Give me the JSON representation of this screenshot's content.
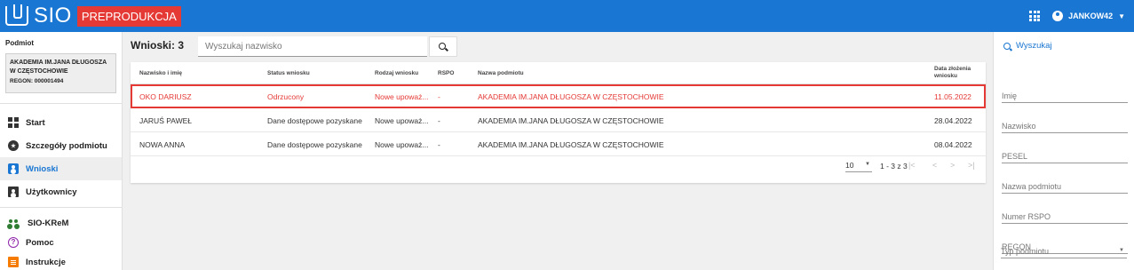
{
  "app": {
    "name": "SIO",
    "env_badge": "PREPRODUKCJA"
  },
  "user": {
    "name": "JANKOW42"
  },
  "sidebar": {
    "subject_label": "Podmiot",
    "subject_name_line1": "AKADEMIA IM.JANA DŁUGOSZA",
    "subject_name_line2": "W CZĘSTOCHOWIE",
    "subject_regon": "REGON: 000001494",
    "items": [
      {
        "label": "Start",
        "icon": "dashboard-icon"
      },
      {
        "label": "Szczegóły podmiotu",
        "icon": "star-circle-icon"
      },
      {
        "label": "Wnioski",
        "icon": "contact-card-icon",
        "active": true
      },
      {
        "label": "Użytkownicy",
        "icon": "users-card-icon"
      },
      {
        "label": "SIO-KReM",
        "icon": "group-icon"
      },
      {
        "label": "Pomoc",
        "icon": "help-icon"
      },
      {
        "label": "Instrukcje",
        "icon": "document-icon"
      }
    ]
  },
  "main": {
    "count_label": "Wnioski: 3",
    "search_placeholder": "Wyszukaj nazwisko",
    "columns": [
      "Nazwisko i imię",
      "Status wniosku",
      "Rodzaj wniosku",
      "RSPO",
      "Nazwa podmiotu",
      "Data złożenia",
      "wniosku"
    ],
    "rows": [
      {
        "name": "OKO DARIUSZ",
        "status": "Odrzucony",
        "type": "Nowe upoważ...",
        "rspo": "-",
        "entity": "AKADEMIA IM.JANA DŁUGOSZA W CZĘSTOCHOWIE",
        "date": "11.05.2022",
        "highlighted": true
      },
      {
        "name": "JARUŚ PAWEŁ",
        "status": "Dane dostępowe pozyskane",
        "type": "Nowe upoważ...",
        "rspo": "-",
        "entity": "AKADEMIA IM.JANA DŁUGOSZA W CZĘSTOCHOWIE",
        "date": "28.04.2022"
      },
      {
        "name": "NOWA ANNA",
        "status": "Dane dostępowe pozyskane",
        "type": "Nowe upoważ...",
        "rspo": "-",
        "entity": "AKADEMIA IM.JANA DŁUGOSZA W CZĘSTOCHOWIE",
        "date": "08.04.2022"
      }
    ],
    "pager": {
      "per_page": "10",
      "range": "1 - 3 z 3"
    }
  },
  "right_panel": {
    "title": "Wyszukaj",
    "fields": [
      "Imię",
      "Nazwisko",
      "PESEL",
      "Nazwa podmiotu",
      "Numer RSPO",
      "REGON",
      "Typ podmiotu"
    ]
  },
  "colors": {
    "primary": "#1976d2",
    "badge": "#e53935",
    "highlight": "#e53935"
  }
}
